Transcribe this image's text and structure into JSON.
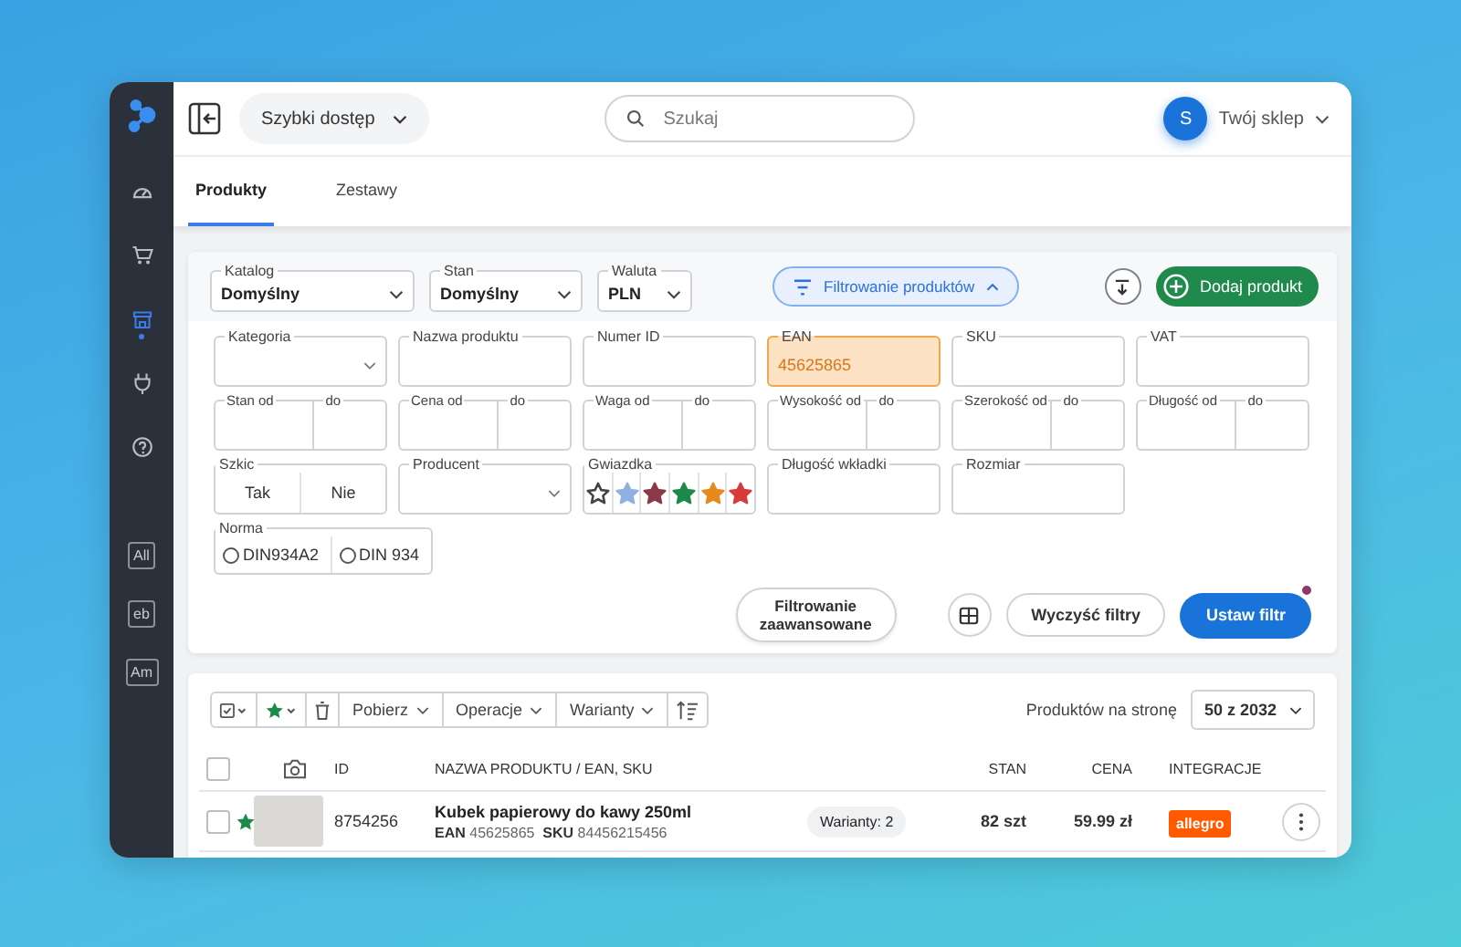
{
  "sidebar": {
    "nav_items": [
      {
        "selected": false
      },
      {
        "selected": false
      },
      {
        "selected": true
      },
      {
        "selected": false
      },
      {
        "selected": false
      }
    ],
    "app_badges": [
      "All",
      "eb",
      "Am"
    ]
  },
  "topbar": {
    "quick_access": "Szybki dostęp",
    "search": {
      "placeholder": "Szukaj"
    },
    "account": {
      "initial": "S",
      "name": "Twój sklep"
    }
  },
  "tabs": [
    {
      "label": "Produkty",
      "selected": true
    },
    {
      "label": "Zestawy",
      "selected": false
    }
  ],
  "filters": {
    "selects": [
      {
        "label": "Katalog",
        "value": "Domyślny"
      },
      {
        "label": "Stan",
        "value": "Domyślny"
      },
      {
        "label": "Waluta",
        "value": "PLN"
      }
    ],
    "toggle_button": {
      "label": "Filtrowanie produktów",
      "expanded": true
    },
    "add_button": "Dodaj produkt",
    "rows": [
      [
        {
          "kind": "select",
          "label": "Kategoria"
        },
        {
          "kind": "text",
          "label": "Nazwa produktu",
          "highlighted": false
        },
        {
          "kind": "text",
          "label": "Numer ID",
          "highlighted": false
        },
        {
          "kind": "text",
          "label": "EAN",
          "value": "45625865",
          "highlighted": true
        },
        {
          "kind": "text",
          "label": "SKU",
          "highlighted": false
        },
        {
          "kind": "text",
          "label": "VAT",
          "highlighted": false
        }
      ],
      [
        {
          "kind": "range",
          "label": "Stan od",
          "to_label": "do"
        },
        {
          "kind": "range",
          "label": "Cena od",
          "to_label": "do"
        },
        {
          "kind": "range",
          "label": "Waga od",
          "to_label": "do"
        },
        {
          "kind": "range",
          "label": "Wysokość od",
          "to_label": "do"
        },
        {
          "kind": "range",
          "label": "Szerokość od",
          "to_label": "do"
        },
        {
          "kind": "range",
          "label": "Długość od",
          "to_label": "do"
        }
      ],
      [
        {
          "kind": "toggle",
          "label": "Szkic",
          "options": [
            {
              "label": "Tak",
              "selected": false
            },
            {
              "label": "Nie",
              "selected": false
            }
          ]
        },
        {
          "kind": "select",
          "label": "Producent"
        },
        {
          "kind": "stars",
          "label": "Gwiazdka",
          "stars": [
            {
              "color": "#444444",
              "filled": false
            },
            {
              "color": "#8fb0e0",
              "filled": true
            },
            {
              "color": "#8b3a4a",
              "filled": true
            },
            {
              "color": "#1e8a4a",
              "filled": true
            },
            {
              "color": "#e8891c",
              "filled": true
            },
            {
              "color": "#d93a3a",
              "filled": true
            }
          ]
        },
        {
          "kind": "text",
          "label": "Długość wkładki",
          "highlighted": false
        },
        {
          "kind": "text",
          "label": "Rozmiar",
          "highlighted": false
        }
      ],
      [
        {
          "kind": "radio",
          "label": "Norma",
          "options": [
            {
              "label": "DIN934A2",
              "selected": false
            },
            {
              "label": "DIN 934",
              "selected": false
            }
          ]
        }
      ]
    ],
    "advanced_button": "Filtrowanie zaawansowane",
    "clear_button": "Wyczyść filtry",
    "apply_button": {
      "label": "Ustaw filtr",
      "notification": true
    }
  },
  "table": {
    "toolbar": [
      "Pobierz",
      "Operacje",
      "Warianty"
    ],
    "per_page_label": "Produktów na stronę",
    "per_page_value": "50 z 2032",
    "select_all": {
      "checked": false
    },
    "columns": [
      "ID",
      "NAZWA PRODUKTU / EAN, SKU",
      "STAN",
      "CENA",
      "INTEGRACJE"
    ],
    "rows": [
      {
        "checked": false,
        "starred": true,
        "id": "8754256",
        "name": "Kubek papierowy do kawy 250ml",
        "ean_label": "EAN",
        "ean": "45625865",
        "sku_label": "SKU",
        "sku": "84456215456",
        "variants": "Warianty: 2",
        "stock": "82 szt",
        "price": "59.99 zł",
        "integration": "allegro"
      }
    ]
  }
}
